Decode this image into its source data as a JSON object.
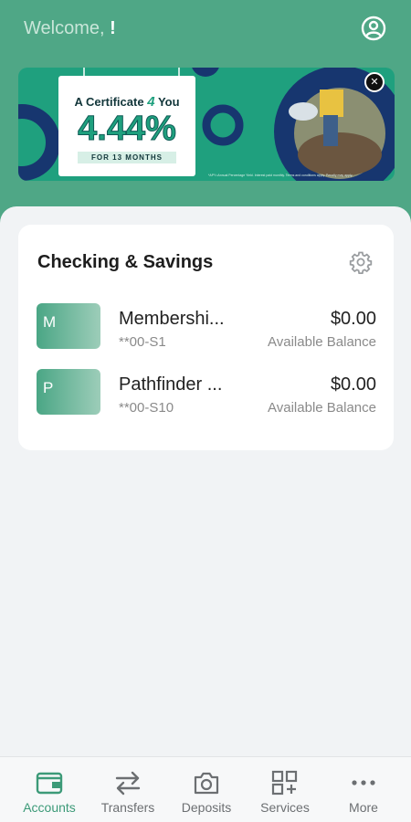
{
  "header": {
    "welcome_text": "Welcome,",
    "user_name": "!",
    "colors": {
      "background": "#4fa786",
      "welcome": "#c9e6d9"
    },
    "profile_icon": "user-circle-icon"
  },
  "promo_banner": {
    "title_pre": "A Certificate",
    "title_number": "4",
    "title_post": "You",
    "rate": "4.44%",
    "term": "FOR 13 MONTHS",
    "fine_print": "*APY=Annual Percentage Yield. Interest paid monthly. Terms and conditions apply. Penalty may apply.",
    "close_icon": "close-icon",
    "colors": {
      "background": "#1fa07e",
      "ring": "#17366f",
      "accent": "#1fa07e"
    }
  },
  "accounts_card": {
    "title": "Checking & Savings",
    "settings_icon": "gear-icon",
    "accounts": [
      {
        "initial": "M",
        "name": "Membershi...",
        "number": "**00-S1",
        "balance": "$0.00",
        "balance_label": "Available Balance"
      },
      {
        "initial": "P",
        "name": "Pathfinder ...",
        "number": "**00-S10",
        "balance": "$0.00",
        "balance_label": "Available Balance"
      }
    ]
  },
  "bottom_nav": {
    "active_color": "#3c9a78",
    "items": [
      {
        "label": "Accounts",
        "icon": "wallet-icon",
        "active": true
      },
      {
        "label": "Transfers",
        "icon": "transfer-arrows-icon",
        "active": false
      },
      {
        "label": "Deposits",
        "icon": "camera-icon",
        "active": false
      },
      {
        "label": "Services",
        "icon": "grid-plus-icon",
        "active": false
      },
      {
        "label": "More",
        "icon": "more-dots-icon",
        "active": false
      }
    ]
  }
}
